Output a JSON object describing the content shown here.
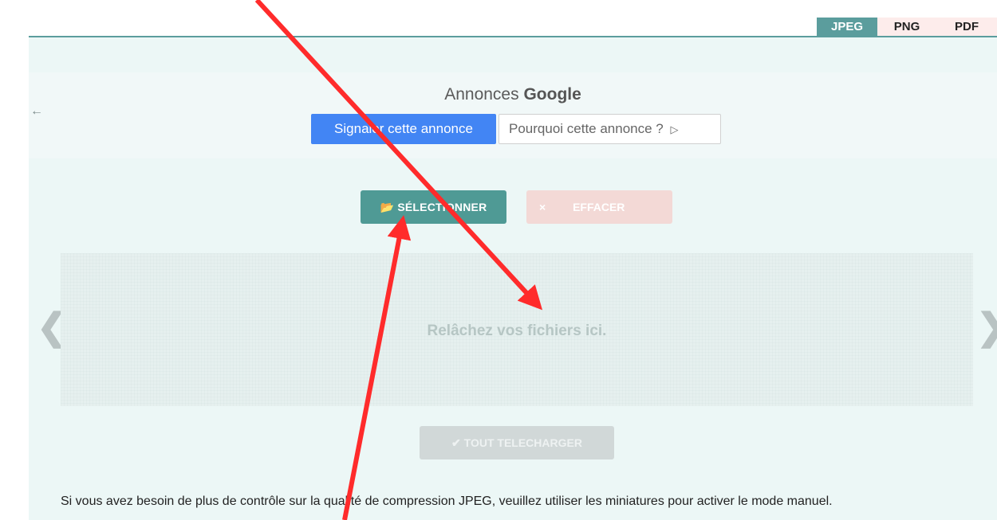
{
  "tabs": [
    {
      "label": "JPEG",
      "active": true
    },
    {
      "label": "PNG",
      "active": false
    },
    {
      "label": "PDF",
      "active": false
    }
  ],
  "ads": {
    "back_icon": "arrow-left-icon",
    "title_prefix": "Annonces",
    "title_brand": "Google",
    "report_label": "Signaler cette annonce",
    "why_label": "Pourquoi cette annonce ?",
    "why_icon": "play-outline-icon"
  },
  "actions": {
    "select_label": "SÉLECTIONNER",
    "select_icon": "folder-open-icon",
    "clear_label": "EFFACER",
    "clear_icon": "close-icon"
  },
  "dropzone": {
    "text": "Relâchez vos fichiers ici."
  },
  "carousel": {
    "prev_icon": "chevron-left-icon",
    "next_icon": "chevron-right-icon"
  },
  "download": {
    "label": "TOUT TELECHARGER",
    "icon": "check-icon"
  },
  "info_text": "Si vous avez besoin de plus de contrôle sur la qualité de compression JPEG, veuillez utiliser les miniatures pour activer le mode manuel.",
  "colors": {
    "accent": "#5b9d9d",
    "select_button": "#4f9a95",
    "annotation_arrow": "#ff2b2b",
    "ad_report_button": "#4285f4"
  }
}
